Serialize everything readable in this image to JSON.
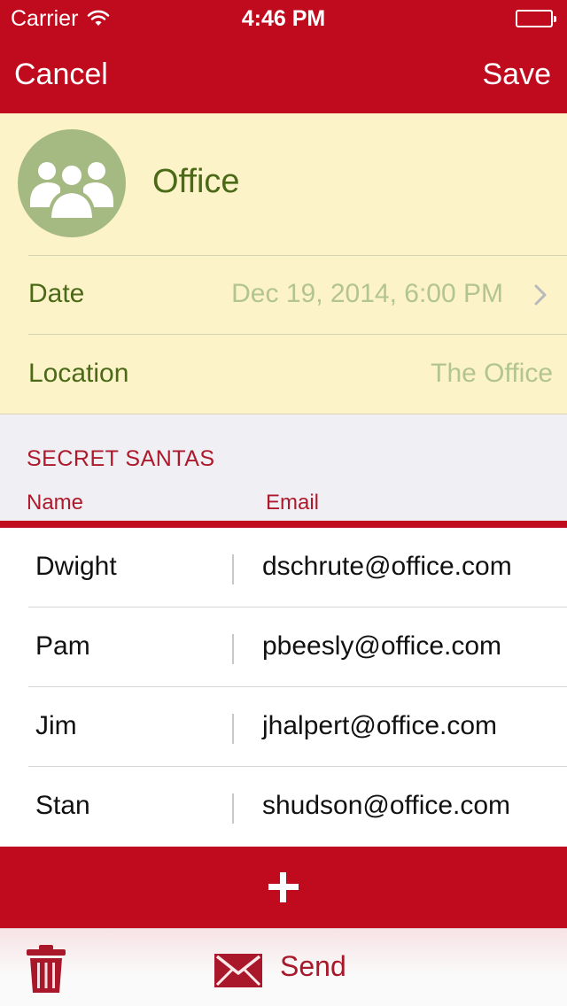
{
  "status_bar": {
    "carrier": "Carrier",
    "time": "4:46 PM"
  },
  "nav": {
    "cancel_label": "Cancel",
    "save_label": "Save"
  },
  "event": {
    "icon": "group-icon",
    "name": "Office",
    "date_label": "Date",
    "date_value": "Dec 19, 2014, 6:00 PM",
    "location_label": "Location",
    "location_value": "The Office"
  },
  "santas": {
    "section_title": "SECRET SANTAS",
    "col_name": "Name",
    "col_email": "Email",
    "rows": [
      {
        "name": "Dwight",
        "email": "dschrute@office.com"
      },
      {
        "name": "Pam",
        "email": "pbeesly@office.com"
      },
      {
        "name": "Jim",
        "email": "jhalpert@office.com"
      },
      {
        "name": "Stan",
        "email": "shudson@office.com"
      }
    ]
  },
  "toolbar": {
    "send_label": "Send"
  },
  "colors": {
    "accent": "#c00b1e",
    "event_background": "#fdf3c9",
    "event_text": "#4a6a18",
    "event_value_text": "#b3c58e",
    "avatar": "#a5ba82"
  }
}
